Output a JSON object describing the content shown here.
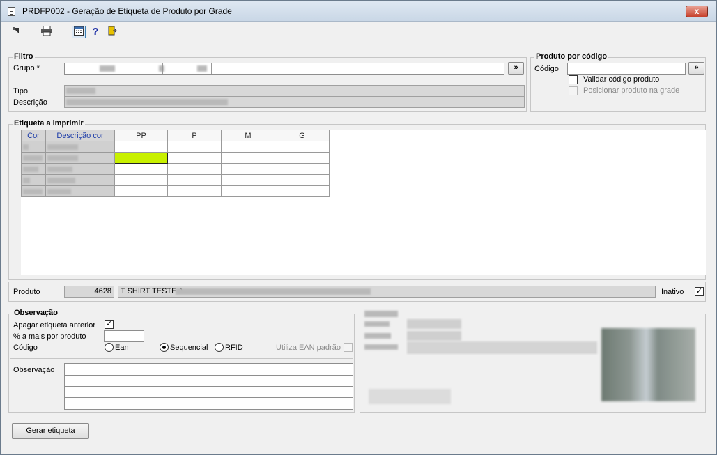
{
  "window": {
    "title": "PRDFP002 - Geração de Etiqueta de Produto por Grade",
    "close_label": "x"
  },
  "toolbar": {
    "icons": [
      "exit-arrow-icon",
      "printer-icon",
      "calendar-icon",
      "help-icon",
      "door-exit-icon"
    ],
    "help_label": "?"
  },
  "filtro": {
    "legend": "Filtro",
    "grupo_label": "Grupo *",
    "browse_label": "»",
    "tipo_label": "Tipo",
    "descricao_label": "Descrição"
  },
  "produto_codigo": {
    "legend": "Produto por código",
    "codigo_label": "Código",
    "browse_label": "»",
    "validar_label": "Validar código produto",
    "posicionar_label": "Posicionar produto na grade"
  },
  "etiqueta": {
    "legend": "Etiqueta a imprimir",
    "columns": [
      "Cor",
      "Descrição cor",
      "PP",
      "P",
      "M",
      "G"
    ],
    "row_count": 5
  },
  "produto": {
    "label": "Produto",
    "code": "4628",
    "description": "T SHIRT TESTE A",
    "inativo_label": "Inativo",
    "inativo_checked": "✓"
  },
  "observacao": {
    "legend": "Observação",
    "apagar_label": "Apagar etiqueta anterior",
    "apagar_checked": "✓",
    "percent_label": "% a mais por produto",
    "codigo_label": "Código",
    "radio_options": [
      "Ean",
      "Sequencial",
      "RFID"
    ],
    "selected_radio": "Sequencial",
    "utiliza_ean_label": "Utiliza EAN padrão",
    "observacao_label": "Observação"
  },
  "actions": {
    "gerar_label": "Gerar etiqueta"
  },
  "colors": {
    "highlight_cell": "#c8f000",
    "header_text": "#1a3aa8",
    "close_red": "#c7402b"
  }
}
